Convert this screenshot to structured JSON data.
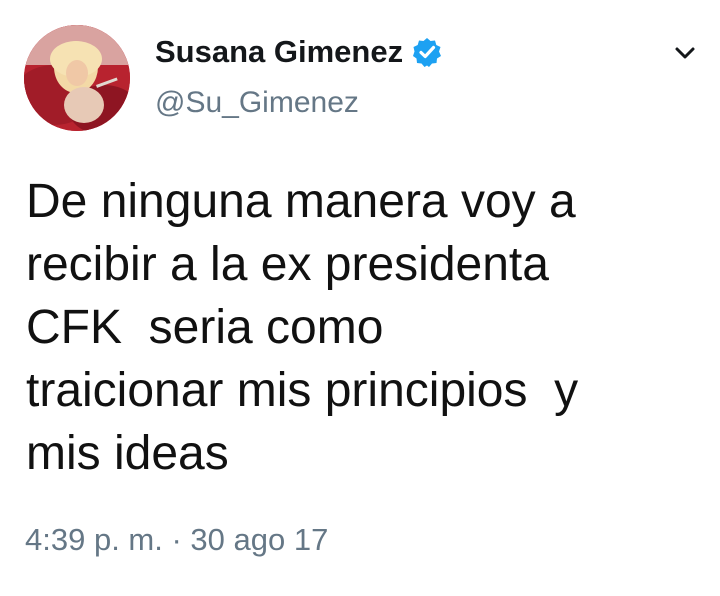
{
  "user": {
    "display_name": "Susana Gimenez",
    "handle": "@Su_Gimenez",
    "verified": true,
    "avatar_icon": "profile-photo"
  },
  "menu": {
    "icon": "chevron-down-icon"
  },
  "tweet": {
    "text": "De ninguna manera voy a\nrecibir a la ex presidenta\nCFK  seria como\ntraicionar mis principios  y\nmis ideas",
    "timestamp": "4:39 p. m. · 30 ago 17"
  },
  "colors": {
    "verified_badge": "#1da1f2",
    "secondary_text": "#657786",
    "primary_text": "#14171a"
  }
}
